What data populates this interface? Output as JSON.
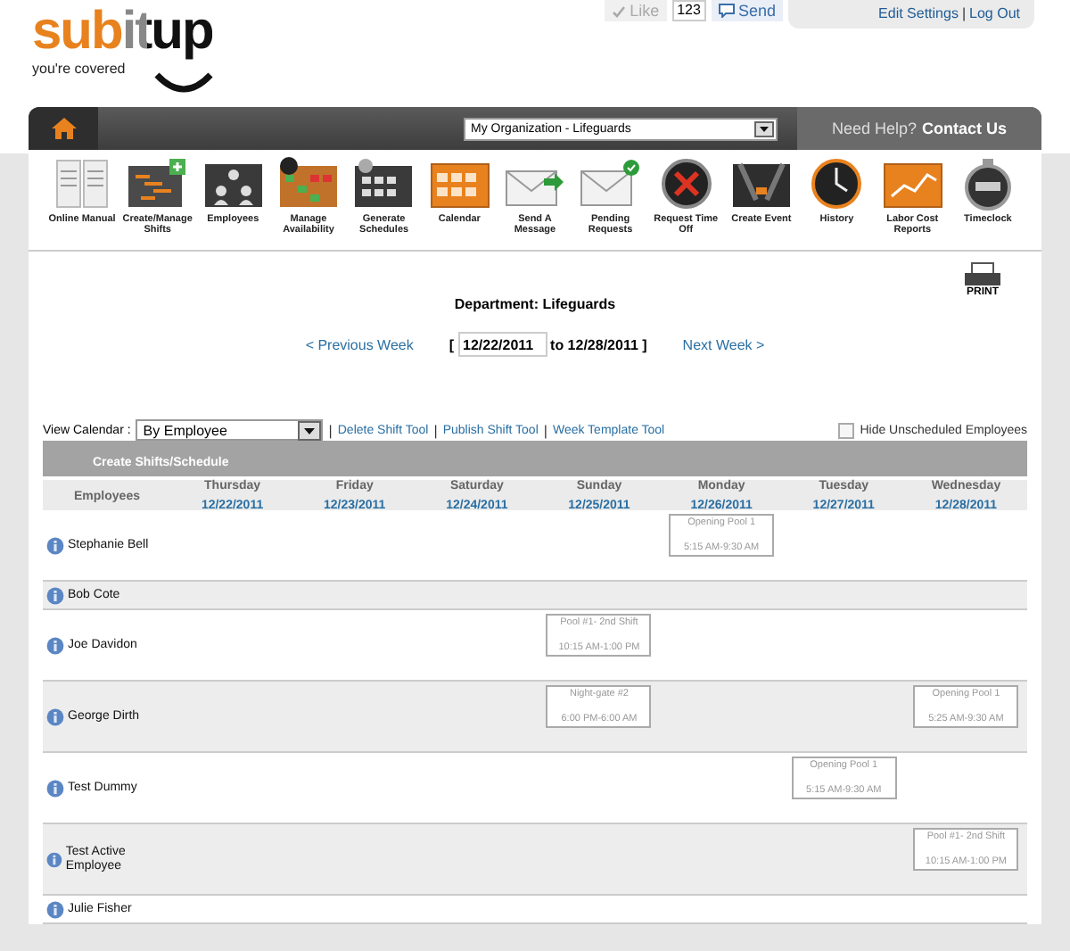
{
  "logo": {
    "name": "subitup",
    "tagline": "you're covered"
  },
  "social": {
    "like": "Like",
    "like_disabled": true,
    "count": "123",
    "send": "Send"
  },
  "account": {
    "links": [
      "Edit Settings",
      "Log Out"
    ],
    "separator": "|"
  },
  "nav": {
    "organization": "My Organization - Lifeguards",
    "help_prefix": "Need Help?",
    "help_link": "Contact Us"
  },
  "toolbar": [
    {
      "label": "Online Manual"
    },
    {
      "label": "Create/Manage Shifts"
    },
    {
      "label": "Employees"
    },
    {
      "label": "Manage Availability"
    },
    {
      "label": "Generate Schedules"
    },
    {
      "label": "Calendar"
    },
    {
      "label": "Send A Message"
    },
    {
      "label": "Pending Requests"
    },
    {
      "label": "Request Time Off"
    },
    {
      "label": "Create Event"
    },
    {
      "label": "History"
    },
    {
      "label": "Labor Cost Reports"
    },
    {
      "label": "Timeclock"
    }
  ],
  "print": "PRINT",
  "department": "Department: Lifeguards",
  "week": {
    "previous": "< Previous Week",
    "open_bracket": "[",
    "start": "12/22/2011",
    "end_text": "to 12/28/2011 ]",
    "next": "Next Week >"
  },
  "view_calendar": {
    "label": "View Calendar :",
    "value": "By Employee",
    "separator": "|",
    "tools": [
      "Delete Shift Tool",
      "Publish Shift Tool",
      "Week Template Tool"
    ],
    "hide_unscheduled": {
      "label": "Hide Unscheduled Employees",
      "checked": false
    }
  },
  "section_title": "Create Shifts/Schedule",
  "table": {
    "first_column": "Employees",
    "days": [
      {
        "name": "Thursday",
        "date": "12/22/2011"
      },
      {
        "name": "Friday",
        "date": "12/23/2011"
      },
      {
        "name": "Saturday",
        "date": "12/24/2011"
      },
      {
        "name": "Sunday",
        "date": "12/25/2011"
      },
      {
        "name": "Monday",
        "date": "12/26/2011"
      },
      {
        "name": "Tuesday",
        "date": "12/27/2011"
      },
      {
        "name": "Wednesday",
        "date": "12/28/2011"
      }
    ],
    "rows": [
      {
        "name": "Stephanie Bell",
        "shifts": {
          "monday": {
            "title": "Opening Pool 1",
            "time": "5:15 AM-9:30 AM"
          }
        }
      },
      {
        "name": "Bob Cote"
      },
      {
        "name": "Joe Davidon",
        "shifts": {
          "sunday": {
            "title": "Pool #1- 2nd Shift",
            "time": "10:15 AM-1:00 PM"
          }
        }
      },
      {
        "name": "George Dirth",
        "shifts": {
          "sunday": {
            "title": "Night-gate #2",
            "time": "6:00 PM-6:00 AM"
          },
          "wednesday": {
            "title": "Opening Pool 1",
            "time": "5:25 AM-9:30 AM"
          }
        }
      },
      {
        "name": "Test Dummy",
        "shifts": {
          "tuesday": {
            "title": "Opening Pool 1",
            "time": "5:15 AM-9:30 AM"
          }
        }
      },
      {
        "name": "Test Active Employee",
        "shifts": {
          "wednesday": {
            "title": "Pool #1- 2nd Shift",
            "time": "10:15 AM-1:00 PM"
          }
        }
      },
      {
        "name": "Julie Fisher"
      }
    ]
  }
}
